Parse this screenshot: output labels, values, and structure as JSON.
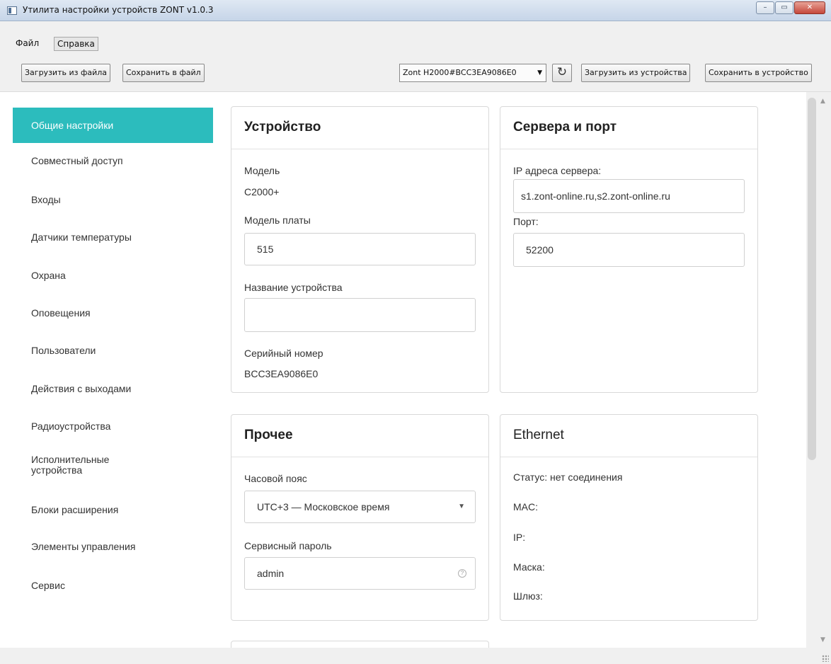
{
  "window": {
    "title": "Утилита настройки устройств ZONT v1.0.3",
    "minimize_icon": "minimize-icon",
    "maximize_icon": "maximize-icon",
    "close_icon": "close-icon",
    "minimize_label": "–",
    "maximize_label": "▭",
    "close_label": "✕"
  },
  "menu": {
    "file": "Файл",
    "help": "Справка"
  },
  "toolbar": {
    "load_file": "Загрузить из файла",
    "save_file": "Сохранить в файл",
    "device_select": "Zont H2000#BCC3EA9086E0",
    "refresh_icon": "refresh-icon",
    "load_device": "Загрузить из устройства",
    "save_device": "Сохранить в устройство"
  },
  "sidebar": {
    "items": [
      {
        "label": "Общие настройки",
        "active": true
      },
      {
        "label": "Совместный доступ"
      },
      {
        "label": "Входы"
      },
      {
        "label": "Датчики температуры"
      },
      {
        "label": "Охрана"
      },
      {
        "label": "Оповещения"
      },
      {
        "label": "Пользователи"
      },
      {
        "label": "Действия с выходами"
      },
      {
        "label": "Радиоустройства"
      },
      {
        "label": "Исполнительные",
        "label2": "устройства"
      },
      {
        "label": "Блоки расширения"
      },
      {
        "label": "Элементы управления"
      },
      {
        "label": "Сервис"
      }
    ],
    "accent_color": "#2cbcbd"
  },
  "device_card": {
    "title": "Устройство",
    "model_label": "Модель",
    "model_value": "C2000+",
    "board_label": "Модель платы",
    "board_value": "515",
    "name_label": "Название устройства",
    "name_value": "",
    "serial_label": "Серийный номер",
    "serial_value": "BCC3EA9086E0"
  },
  "server_card": {
    "title": "Сервера и порт",
    "ip_label": "IP адреса сервера:",
    "ip_value": "s1.zont-online.ru,s2.zont-online.ru",
    "port_label": "Порт:",
    "port_value": "52200"
  },
  "other_card": {
    "title": "Прочее",
    "tz_label": "Часовой пояс",
    "tz_value": "UTC+3 — Московское время",
    "pwd_label": "Сервисный пароль",
    "pwd_value": "admin"
  },
  "ethernet_card": {
    "title": "Ethernet",
    "status": "Статус: нет соединения",
    "mac": "MAC:",
    "ip": "IP:",
    "mask": "Маска:",
    "gateway": "Шлюз:"
  }
}
